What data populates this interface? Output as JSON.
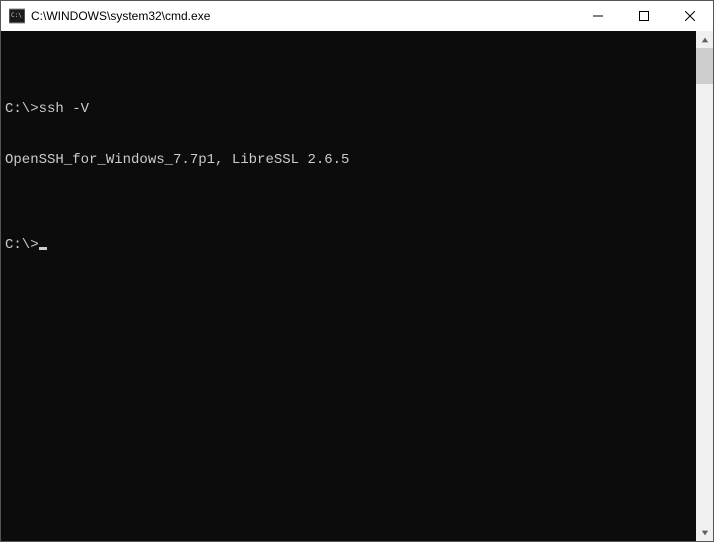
{
  "window": {
    "title": "C:\\WINDOWS\\system32\\cmd.exe"
  },
  "terminal": {
    "lines": [
      "",
      "C:\\>ssh -V",
      "OpenSSH_for_Windows_7.7p1, LibreSSL 2.6.5",
      "",
      "C:\\>"
    ]
  }
}
